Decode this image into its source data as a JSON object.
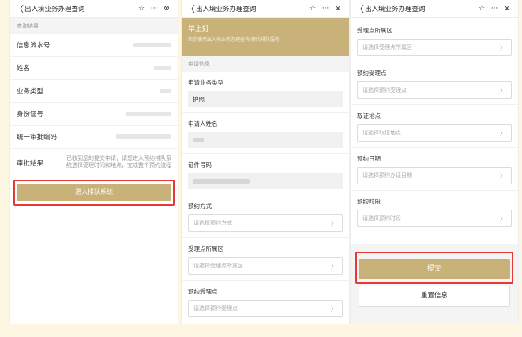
{
  "nav": {
    "back": "〈",
    "title": "出入境业务办理查询",
    "star": "☆",
    "more": "···",
    "close": "⊗"
  },
  "screen1": {
    "section": "查询结果",
    "rows": [
      "信息流水号",
      "姓名",
      "业务类型",
      "身份证号",
      "统一审批编码"
    ],
    "result_label": "审批结果",
    "result_text": "已收到您的提交申请，请您进入预约排队系统选择受理时间和地点，完成整个预约流程",
    "button": "进入排队系统"
  },
  "screen2": {
    "greeting": "早上好",
    "welcome": "欢迎使用出入境业务办理查询·预约排队服务",
    "section": "申请信息",
    "business_type_label": "申请业务类型",
    "business_type_value": "护照",
    "name_label": "申请人姓名",
    "id_label": "证件号码",
    "method_label": "预约方式",
    "method_placeholder": "请选择预约方式",
    "district_label": "受理点所属区",
    "district_placeholder": "请选择受理点所属区",
    "point_label": "预约受理点",
    "point_placeholder": "请选择预约受理点"
  },
  "screen3": {
    "fields": [
      {
        "label": "受理点所属区",
        "placeholder": "请选择受理点所属区"
      },
      {
        "label": "预约受理点",
        "placeholder": "请选择预约受理点"
      },
      {
        "label": "取证地点",
        "placeholder": "请选择取证地点"
      },
      {
        "label": "预约日期",
        "placeholder": "请选择预约办证日期"
      },
      {
        "label": "预约时段",
        "placeholder": "请选择预约时段"
      }
    ],
    "submit": "提交",
    "reset": "重置信息"
  },
  "colors": {
    "gold": "#c8b27a",
    "highlight": "#e53935",
    "background": "#fdf6e3"
  }
}
